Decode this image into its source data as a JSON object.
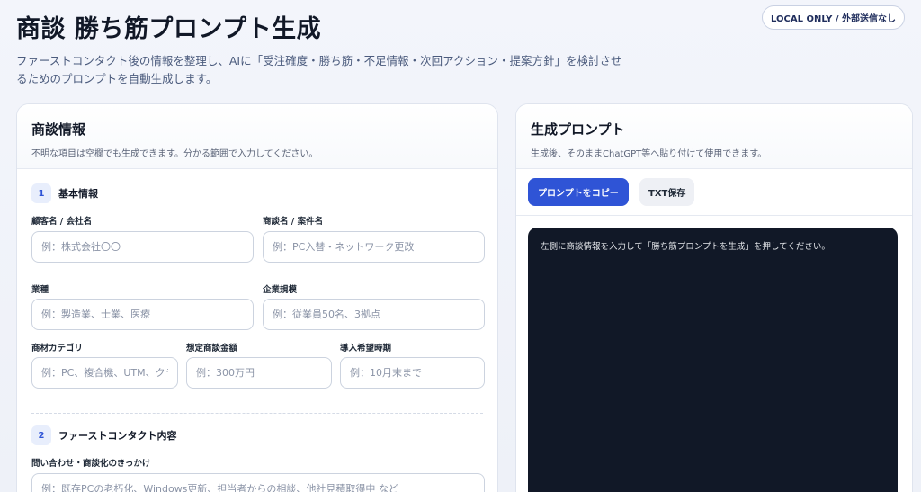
{
  "header": {
    "title": "商談 勝ち筋プロンプト生成",
    "badge": "LOCAL ONLY / 外部送信なし",
    "description": "ファーストコンタクト後の情報を整理し、AIに「受注確度・勝ち筋・不足情報・次回アクション・提案方針」を検討させるためのプロンプトを自動生成します。"
  },
  "left_panel": {
    "title": "商談情報",
    "subtitle": "不明な項目は空欄でも生成できます。分かる範囲で入力してください。",
    "section1": {
      "number": "1",
      "title": "基本情報",
      "fields": {
        "customer": {
          "label": "顧客名 / 会社名",
          "placeholder": "例：株式会社〇〇",
          "value": ""
        },
        "deal": {
          "label": "商談名 / 案件名",
          "placeholder": "例：PC入替・ネットワーク更改",
          "value": ""
        },
        "industry": {
          "label": "業種",
          "placeholder": "例：製造業、士業、医療",
          "value": ""
        },
        "scale": {
          "label": "企業規模",
          "placeholder": "例：従業員50名、3拠点",
          "value": ""
        },
        "category": {
          "label": "商材カテゴリ",
          "placeholder": "例：PC、複合機、UTM、クラウド",
          "value": ""
        },
        "amount": {
          "label": "想定商談金額",
          "placeholder": "例：300万円",
          "value": ""
        },
        "timing": {
          "label": "導入希望時期",
          "placeholder": "例：10月末まで",
          "value": ""
        }
      }
    },
    "section2": {
      "number": "2",
      "title": "ファーストコンタクト内容",
      "fields": {
        "trigger": {
          "label": "問い合わせ・商談化のきっかけ",
          "placeholder": "例：既存PCの老朽化、Windows更新、担当者からの相談、他社見積取得中 など",
          "value": ""
        }
      }
    }
  },
  "right_panel": {
    "title": "生成プロンプト",
    "subtitle": "生成後、そのままChatGPT等へ貼り付けて使用できます。",
    "copy_button": "プロンプトをコピー",
    "txt_button": "TXT保存",
    "output_text": "左側に商談情報を入力して「勝ち筋プロンプトを生成」を押してください。"
  },
  "colors": {
    "accent": "#2f54d6",
    "output_bg": "#111827"
  }
}
